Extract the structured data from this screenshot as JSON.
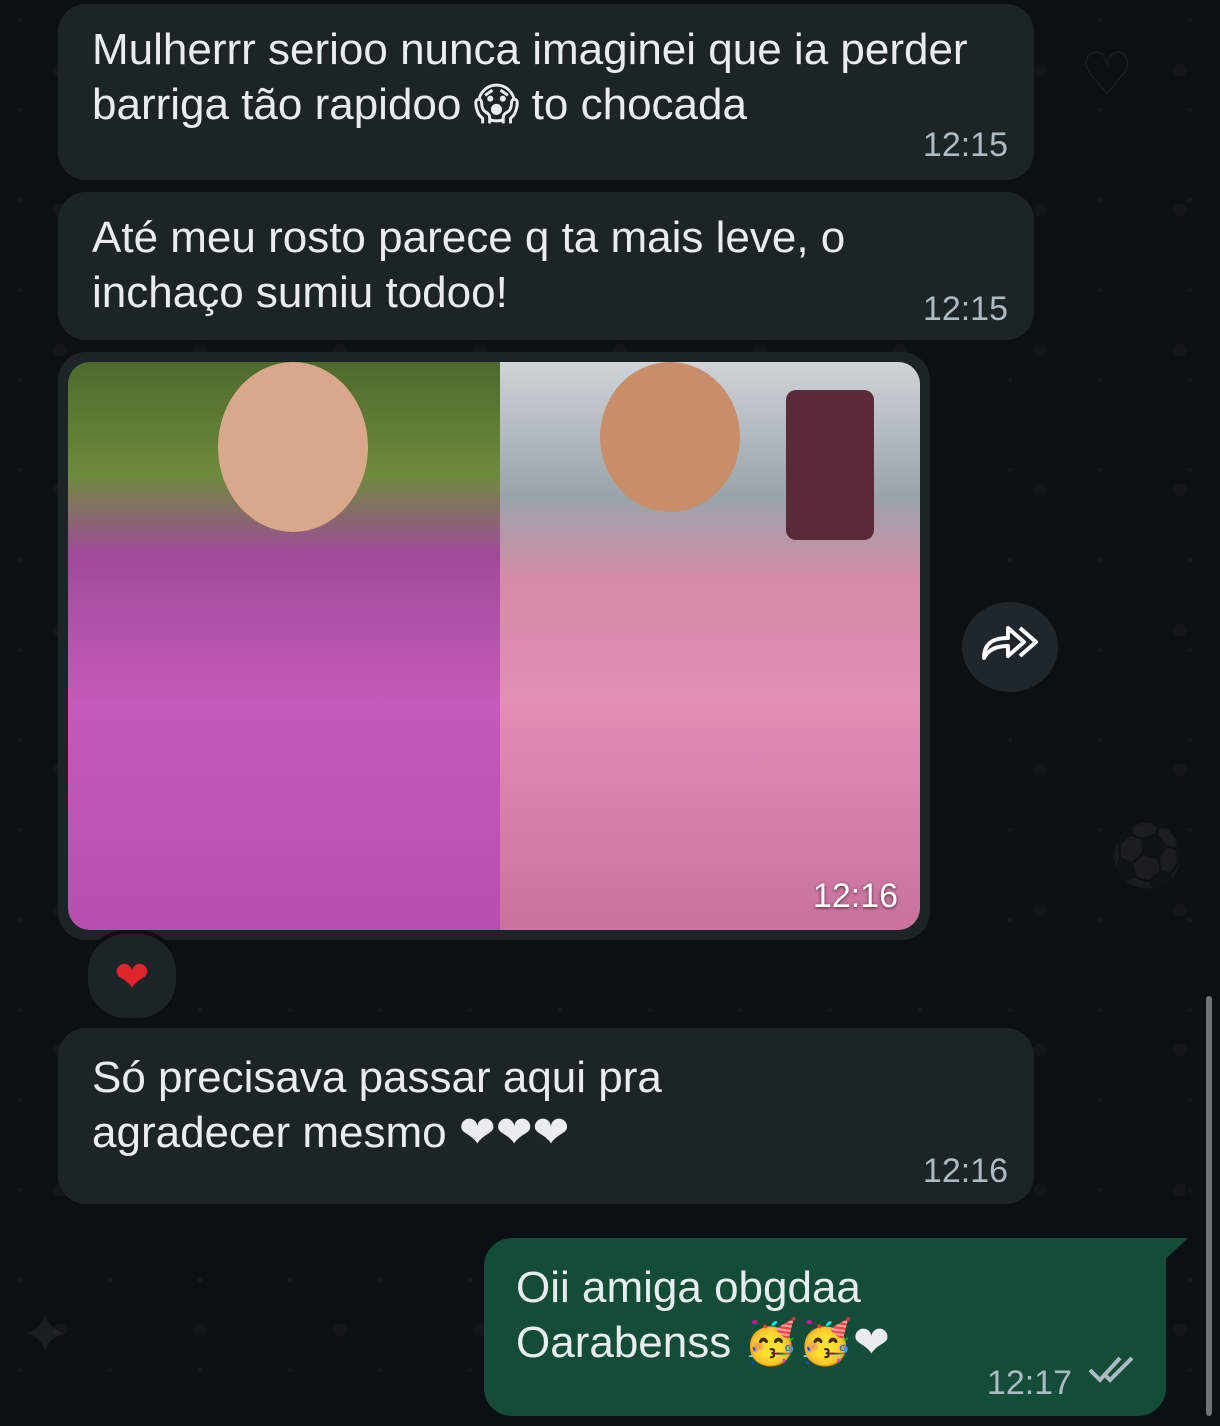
{
  "messages": [
    {
      "id": "m1",
      "text": "Mulherrr serioo nunca imaginei que ia perder\nbarriga tão rapidoo 😱 to chocada",
      "time": "12:15"
    },
    {
      "id": "m2",
      "text": "Até meu rosto parece q ta mais leve, o\ninchaço sumiu todoo!",
      "time": "12:15"
    },
    {
      "id": "m3",
      "type": "image",
      "time": "12:16",
      "reaction": "❤"
    },
    {
      "id": "m4",
      "text": "Só precisava passar aqui pra\nagradecer mesmo ❤❤❤",
      "time": "12:16"
    },
    {
      "id": "m5",
      "text": "Oii amiga obgdaa\nOarabenss 🥳🥳❤",
      "time": "12:17",
      "status": "read"
    }
  ],
  "icons": {
    "forward": "forward-icon",
    "read_ticks": "double-check-icon"
  },
  "colors": {
    "incoming": "#1d2428",
    "outgoing": "#144d37",
    "background": "#0b1014"
  }
}
